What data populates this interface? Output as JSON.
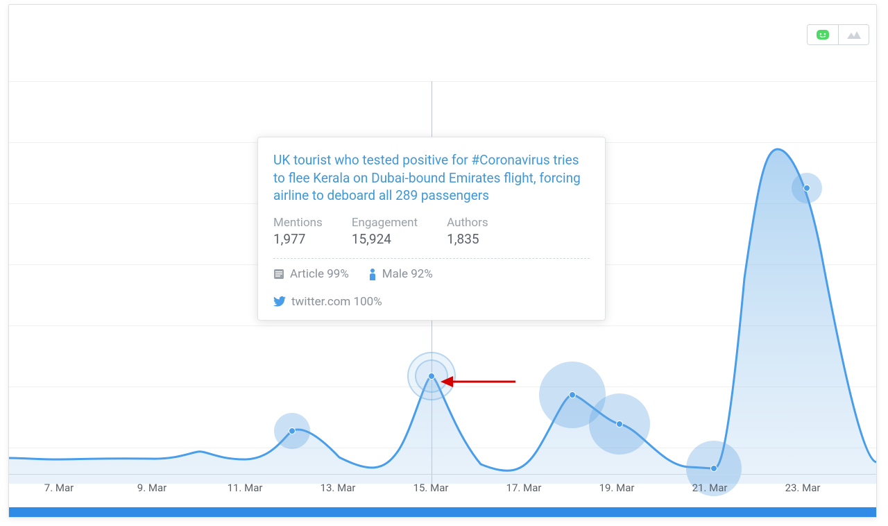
{
  "chart_data": {
    "type": "area",
    "xlabel": "",
    "ylabel": "",
    "ylim": [
      0,
      6000
    ],
    "x_ticks": [
      "7. Mar",
      "9. Mar",
      "11. Mar",
      "13. Mar",
      "15. Mar",
      "17. Mar",
      "19. Mar",
      "21. Mar",
      "23. Mar"
    ],
    "series": [
      {
        "name": "Mentions",
        "x": [
          6,
          7,
          8,
          9,
          10,
          11,
          12,
          13,
          14,
          15,
          16,
          17,
          18,
          19,
          20,
          21,
          22,
          23,
          24
        ],
        "values": [
          420,
          400,
          430,
          540,
          480,
          450,
          900,
          620,
          510,
          1977,
          720,
          450,
          1700,
          1100,
          600,
          550,
          5600,
          4900,
          680
        ]
      }
    ],
    "highlight_points": [
      {
        "x": 12,
        "y": 900,
        "radius": 26
      },
      {
        "x": 15,
        "y": 1977,
        "radius": 34,
        "selected": true
      },
      {
        "x": 18,
        "y": 1700,
        "radius": 48
      },
      {
        "x": 19,
        "y": 1100,
        "radius": 44
      },
      {
        "x": 21,
        "y": 550,
        "radius": 40
      },
      {
        "x": 23,
        "y": 4900,
        "radius": 22
      }
    ]
  },
  "toggle": {
    "option_a_icon": "sentiment-icon",
    "option_b_icon": "mountain-icon"
  },
  "tooltip": {
    "headline": "UK tourist who tested positive for #Coronavirus tries to flee Kerala on Dubai-bound Emirates flight, forcing airline to deboard all 289 passengers",
    "stats": {
      "mentions_label": "Mentions",
      "mentions_value": "1,977",
      "engagement_label": "Engagement",
      "engagement_value": "15,924",
      "authors_label": "Authors",
      "authors_value": "1,835"
    },
    "meta": {
      "article_label": "Article 99%",
      "gender_label": "Male 92%",
      "source_label": "twitter.com 100%"
    }
  }
}
